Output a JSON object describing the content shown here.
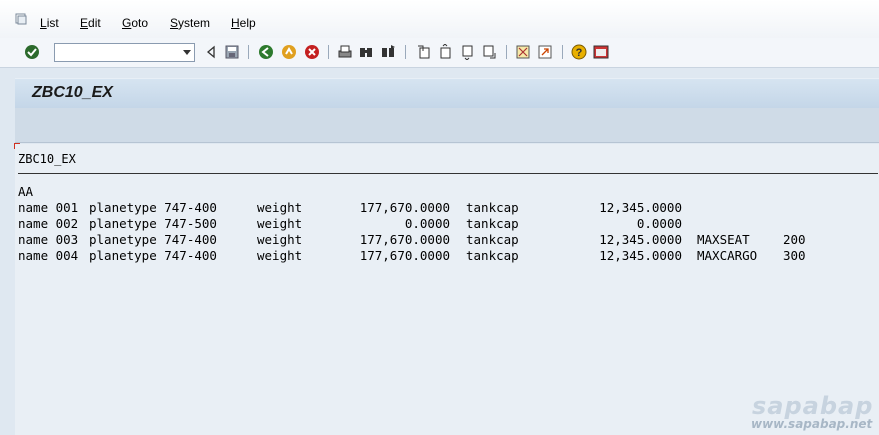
{
  "menu": {
    "items": [
      {
        "label": "List",
        "mnemonic": "L",
        "rest": "ist"
      },
      {
        "label": "Edit",
        "mnemonic": "E",
        "rest": "dit"
      },
      {
        "label": "Goto",
        "mnemonic": "G",
        "rest": "oto"
      },
      {
        "label": "System",
        "mnemonic": "S",
        "rest": "ystem"
      },
      {
        "label": "Help",
        "mnemonic": "H",
        "rest": "elp"
      }
    ]
  },
  "toolbar": {
    "command_field_value": "",
    "icons": [
      "enter-icon",
      "back-triangle-icon",
      "save-icon",
      "back-icon",
      "exit-icon",
      "cancel-icon",
      "print-icon",
      "find-icon",
      "find-next-icon",
      "first-page-icon",
      "previous-page-icon",
      "next-page-icon",
      "last-page-icon",
      "create-session-icon",
      "shortcut-icon",
      "help-icon",
      "layout-menu-icon"
    ]
  },
  "title": "ZBC10_EX",
  "list": {
    "header": "ZBC10_EX",
    "group_label": "AA",
    "rows": [
      {
        "name": "name 001",
        "planetype": "planetype 747-400",
        "weight_label": "weight",
        "weight": "177,670.0000",
        "tank_label": "tankcap",
        "tank": "12,345.0000",
        "extra_label": "",
        "extra": ""
      },
      {
        "name": "name 002",
        "planetype": "planetype 747-500",
        "weight_label": "weight",
        "weight": "0.0000",
        "tank_label": "tankcap",
        "tank": "0.0000",
        "extra_label": "",
        "extra": ""
      },
      {
        "name": "name 003",
        "planetype": "planetype 747-400",
        "weight_label": "weight",
        "weight": "177,670.0000",
        "tank_label": "tankcap",
        "tank": "12,345.0000",
        "extra_label": "MAXSEAT",
        "extra": "200"
      },
      {
        "name": "name 004",
        "planetype": "planetype 747-400",
        "weight_label": "weight",
        "weight": "177,670.0000",
        "tank_label": "tankcap",
        "tank": "12,345.0000",
        "extra_label": "MAXCARGO",
        "extra": "300"
      }
    ]
  },
  "watermark": {
    "brand": "sapabap",
    "url": "www.sapabap.net"
  }
}
